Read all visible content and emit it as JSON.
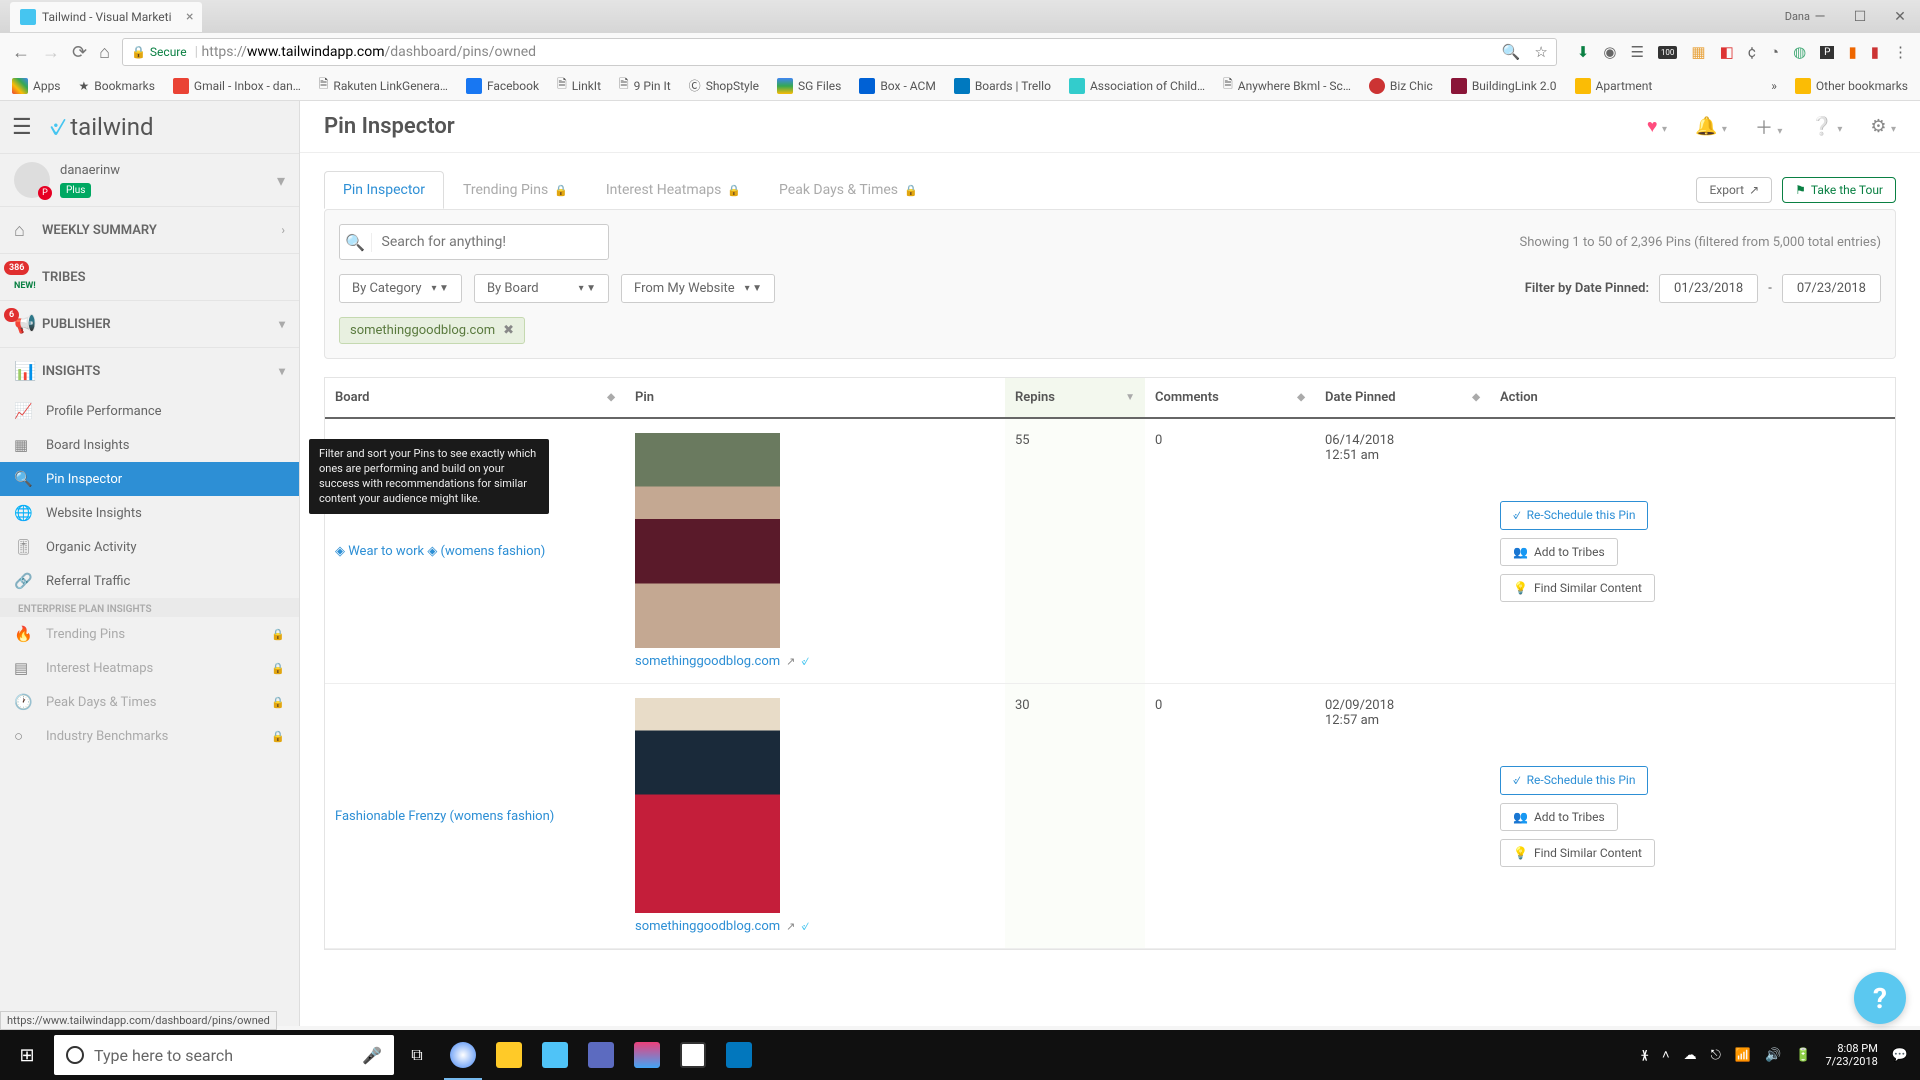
{
  "browser": {
    "tab_title": "Tailwind - Visual Marketi",
    "user_chip": "Dana",
    "url_secure": "Secure",
    "url_prefix": "https://",
    "url_host": "www.tailwindapp.com",
    "url_path": "/dashboard/pins/owned",
    "bookmarks": [
      "Apps",
      "Bookmarks",
      "Gmail - Inbox - dan…",
      "Rakuten LinkGenera…",
      "Facebook",
      "LinkIt",
      "9 Pin It",
      "ShopStyle",
      "SG Files",
      "Box - ACM",
      "Boards | Trello",
      "Association of Child…",
      "Anywhere Bkml - Sc…",
      "Biz Chic",
      "BuildingLink 2.0",
      "Apartment"
    ],
    "bm_overflow": "»",
    "other_bookmarks": "Other bookmarks"
  },
  "sidebar": {
    "logo": "tailwind",
    "user": {
      "name": "danaerinw",
      "plan": "Plus"
    },
    "sections": {
      "weekly": "WEEKLY SUMMARY",
      "tribes": "TRIBES",
      "tribes_badge": "386",
      "tribes_new": "NEW!",
      "publisher": "PUBLISHER",
      "publisher_badge": "6",
      "insights": "INSIGHTS"
    },
    "insights_items": [
      "Profile Performance",
      "Board Insights",
      "Pin Inspector",
      "Website Insights",
      "Organic Activity",
      "Referral Traffic"
    ],
    "enterprise_label": "ENTERPRISE PLAN INSIGHTS",
    "enterprise_items": [
      "Trending Pins",
      "Interest Heatmaps",
      "Peak Days & Times",
      "Industry Benchmarks"
    ]
  },
  "tooltip": "Filter and sort your Pins to see exactly which ones are performing and build on your success with recommendations for similar content your audience might like.",
  "header": {
    "title": "Pin Inspector",
    "tabs": [
      "Pin Inspector",
      "Trending Pins",
      "Interest Heatmaps",
      "Peak Days & Times"
    ],
    "export": "Export",
    "take_tour": "Take the Tour"
  },
  "filters": {
    "search_placeholder": "Search for anything!",
    "showing": "Showing 1 to 50 of 2,396 Pins (filtered from 5,000 total entries)",
    "dd1": "By Category",
    "dd2": "By Board",
    "dd3": "From My Website",
    "date_label": "Filter by Date Pinned:",
    "date_from": "01/23/2018",
    "date_sep": "-",
    "date_to": "07/23/2018",
    "chip": "somethinggoodblog.com"
  },
  "table": {
    "cols": {
      "board": "Board",
      "pin": "Pin",
      "repins": "Repins",
      "comments": "Comments",
      "date": "Date Pinned",
      "action": "Action"
    },
    "rows": [
      {
        "board": "◈ Wear to work ◈ (womens fashion)",
        "pin_domain": "somethinggoodblog.com",
        "repins": "55",
        "comments": "0",
        "date_line1": "06/14/2018",
        "date_line2": "12:51 am"
      },
      {
        "board": "Fashionable Frenzy (womens fashion)",
        "pin_domain": "somethinggoodblog.com",
        "repins": "30",
        "comments": "0",
        "date_line1": "02/09/2018",
        "date_line2": "12:57 am"
      }
    ],
    "actions": {
      "reschedule": "Re-Schedule this Pin",
      "tribes": "Add to Tribes",
      "similar": "Find Similar Content"
    }
  },
  "status_url": "https://www.tailwindapp.com/dashboard/pins/owned",
  "taskbar": {
    "search_placeholder": "Type here to search",
    "time": "8:08 PM",
    "date": "7/23/2018"
  }
}
